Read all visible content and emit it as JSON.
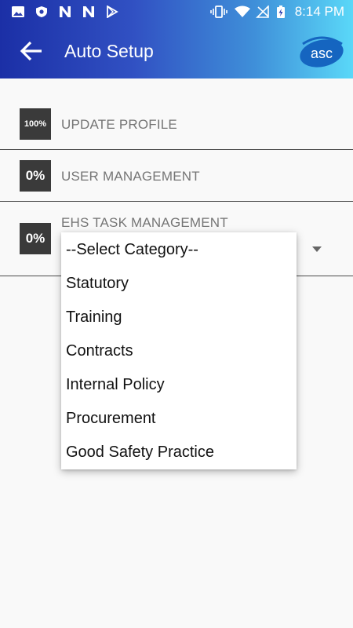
{
  "status_bar": {
    "time": "8:14 PM",
    "left_icons": [
      "image-icon",
      "shield-icon",
      "n-icon",
      "n-icon",
      "play-store-icon"
    ],
    "right_icons": [
      "vibrate-icon",
      "wifi-icon",
      "no-signal-icon",
      "battery-charging-icon"
    ]
  },
  "toolbar": {
    "title": "Auto Setup",
    "logo_text": "asc",
    "colors": {
      "start": "#1b2fa6",
      "end": "#5ad8f8"
    }
  },
  "setup_items": [
    {
      "progress_label": "100%",
      "label": "UPDATE PROFILE"
    },
    {
      "progress_label": "0%",
      "label": "USER MANAGEMENT"
    },
    {
      "progress_label": "0%",
      "label": "EHS TASK MANAGEMENT"
    }
  ],
  "category_dropdown": {
    "options": [
      "--Select Category--",
      "Statutory",
      "Training",
      "Contracts",
      "Internal Policy",
      "Procurement",
      "Good Safety Practice"
    ]
  }
}
